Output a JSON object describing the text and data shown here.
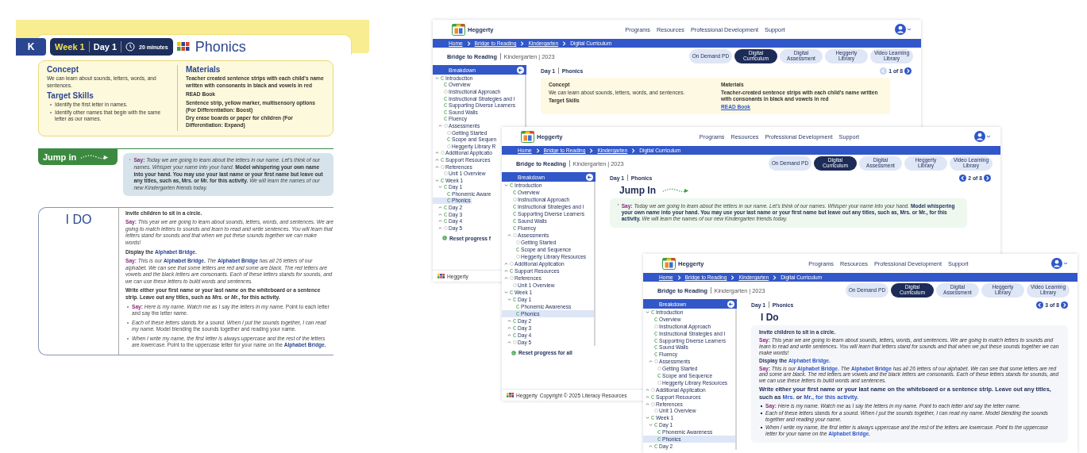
{
  "lesson_page": {
    "grade": "K",
    "week": "Week 1",
    "day": "Day 1",
    "duration": "20 minutes",
    "subject": "Phonics",
    "concept": {
      "heading": "Concept",
      "text": "We can learn about sounds, letters, words, and sentences."
    },
    "target_skills": {
      "heading": "Target Skills",
      "items": [
        "Identify the first letter in names.",
        "Identify other names that begin with the same letter as our names."
      ]
    },
    "materials": {
      "heading": "Materials",
      "items": [
        "Teacher created sentence strips with each child's name written with consonants in black and vowels in red",
        "READ Book",
        "Sentence strip, yellow marker, multisensory options (For Differentiation: Boost)",
        "Dry erase boards or paper for children (For Differentiation: Expand)"
      ]
    },
    "jump_in": {
      "label": "Jump in",
      "say": "Say:",
      "text": "*Today we are going to learn about the letters in our name. Let's think of our names. Whisper your name into your hand.* **Model whispering your own name into your hand. You may use your last name or your first name but leave out any titles, such as, Mrs. or Mr. for this activity.** *We will learn the names of our new Kindergarten friends today.*"
    },
    "i_do": {
      "label": "I DO",
      "paragraphs": [
        {
          "kind": "instruction",
          "text": "Invite children to sit in a circle."
        },
        {
          "kind": "say",
          "say": "Say:",
          "text": "*This year we are going to learn about sounds, letters, words, and sentences. We are going to match letters to sounds and learn to read and write sentences. You will learn that letters stand for sounds and that when we put these sounds together we can make words!*"
        },
        {
          "kind": "instruction",
          "text": "Display the **Alphabet Bridge.**"
        },
        {
          "kind": "say",
          "say": "Say:",
          "text": "*This is our* **Alphabet Bridge.** *The* **Alphabet Bridge** *has all 26 letters of our alphabet. We can see that some letters are red and some are black. The red letters are vowels and the black letters are consonants. Each of these letters stands for sounds, and we can use these letters to build words and sentences.*"
        },
        {
          "kind": "instruction",
          "text": "Write either your first name or your last name on the whiteboard or a sentence strip. Leave out any titles, such as *Mrs.* or *Mr.*, for this activity."
        },
        {
          "kind": "bullet",
          "say": "Say:",
          "text": "*Here is my name. Watch me as I say the letters in my name.* Point to each letter and say the letter name."
        },
        {
          "kind": "bullet",
          "text": "*Each of these letters stands for a sound. When I put the sounds together, I can read my name.* Model blending the sounds together and reading your name."
        },
        {
          "kind": "bullet",
          "text": "*When I write my name, the first letter is always uppercase and the rest of the letters are lowercase.* Point to the uppercase letter for your name on the **Alphabet Bridge.**"
        }
      ]
    }
  },
  "windows": [
    {
      "header": {
        "brand": "Heggerty",
        "nav": [
          "Programs",
          "Resources",
          "Professional Development",
          "Support"
        ],
        "avatar": true
      },
      "breadcrumbs": [
        "Home",
        "Bridge to Reading",
        "Kindergarten",
        "Digital Curriculum"
      ],
      "title": "Bridge to Reading",
      "subtitle": "Kindergarten | 2023",
      "tabs": [
        {
          "label": "On Demand PD",
          "selected": false
        },
        {
          "label": "Digital Curriculum",
          "selected": true
        },
        {
          "label": "Digital Assessment",
          "selected": false
        },
        {
          "label": "Heggerty Library",
          "selected": false
        },
        {
          "label": "Video Learning Library",
          "selected": false
        }
      ],
      "sidebar": {
        "title": "Breakdown",
        "reset": "Reset progress f",
        "items": [
          {
            "label": "Introduction",
            "done": true,
            "expanded": true,
            "selected": false,
            "children": [
              {
                "label": "Overview",
                "done": true,
                "selected": false
              },
              {
                "label": "Instructional Approach",
                "done": false,
                "selected": false
              },
              {
                "label": "Instructional Strategies and I",
                "done": true,
                "selected": false
              },
              {
                "label": "Supporting Diverse Learners",
                "done": true,
                "selected": false
              },
              {
                "label": "Sound Walls",
                "done": true,
                "selected": false
              },
              {
                "label": "Fluency",
                "done": true,
                "selected": false
              },
              {
                "label": "Assessments",
                "done": false,
                "expanded": false,
                "selected": false,
                "children": [
                  {
                    "label": "Getting Started",
                    "done": false,
                    "selected": false
                  },
                  {
                    "label": "Scope and Sequen",
                    "done": true,
                    "selected": false
                  },
                  {
                    "label": "Heggerty Library R",
                    "done": false,
                    "selected": false
                  }
                ]
              }
            ]
          },
          {
            "label": "Additional Applicatio",
            "done": false,
            "expanded": false,
            "selected": false
          },
          {
            "label": "Support Resources",
            "done": true,
            "expanded": false,
            "selected": false
          },
          {
            "label": "References",
            "done": false,
            "expanded": false,
            "selected": false,
            "children": [
              {
                "label": "Unit 1 Overview",
                "done": false,
                "selected": false
              }
            ]
          },
          {
            "label": "Week 1",
            "done": true,
            "expanded": true,
            "selected": false,
            "children": [
              {
                "label": "Day 1",
                "done": true,
                "expanded": true,
                "selected": false,
                "children": [
                  {
                    "label": "Phonemic Aware",
                    "done": true,
                    "selected": false
                  },
                  {
                    "label": "Phonics",
                    "done": true,
                    "selected": true
                  }
                ]
              },
              {
                "label": "Day 2",
                "done": true,
                "expanded": false,
                "selected": false
              },
              {
                "label": "Day 3",
                "done": true,
                "expanded": false,
                "selected": false
              },
              {
                "label": "Day 4",
                "done": true,
                "expanded": false,
                "selected": false
              },
              {
                "label": "Day 5",
                "done": false,
                "expanded": false,
                "selected": false
              }
            ]
          }
        ]
      },
      "day": "Day 1",
      "section": "Phonics",
      "pager": {
        "text": "1 of 8",
        "prev_disabled": true
      },
      "content": {
        "kind": "overview",
        "concept_heading": "Concept",
        "concept_text": "We can learn about sounds, letters, words, and sentences.",
        "skills_heading": "Target Skills",
        "materials_heading": "Materials",
        "materials_text": "Teacher-created sentence strips with each child's name written with consonants in black and vowels in red",
        "materials_link": "READ Book"
      },
      "footer": {
        "brand": "Heggerty"
      }
    },
    {
      "header": {
        "brand": "Heggerty",
        "nav": [
          "Programs",
          "Resources",
          "Professional Development",
          "Support"
        ],
        "avatar": true
      },
      "breadcrumbs": [
        "Home",
        "Bridge to Reading",
        "Kindergarten",
        "Digital Curriculum"
      ],
      "title": "Bridge to Reading",
      "subtitle": "Kindergarten | 2023",
      "tabs": [
        {
          "label": "On Demand PD",
          "selected": false
        },
        {
          "label": "Digital Curriculum",
          "selected": true
        },
        {
          "label": "Digital Assessment",
          "selected": false
        },
        {
          "label": "Heggerty Library",
          "selected": false
        },
        {
          "label": "Video Learning Library",
          "selected": false
        }
      ],
      "sidebar": {
        "title": "Breakdown",
        "reset": "Reset progress for all",
        "items": [
          {
            "label": "Introduction",
            "done": true,
            "expanded": true,
            "selected": false,
            "children": [
              {
                "label": "Overview",
                "done": true,
                "selected": false
              },
              {
                "label": "Instructional Approach",
                "done": false,
                "selected": false
              },
              {
                "label": "Instructional Strategies and I",
                "done": true,
                "selected": false
              },
              {
                "label": "Supporting Diverse Learners",
                "done": true,
                "selected": false
              },
              {
                "label": "Sound Walls",
                "done": true,
                "selected": false
              },
              {
                "label": "Fluency",
                "done": true,
                "selected": false
              },
              {
                "label": "Assessments",
                "done": false,
                "expanded": false,
                "selected": false,
                "children": [
                  {
                    "label": "Getting Started",
                    "done": false,
                    "selected": false
                  },
                  {
                    "label": "Scope and Sequence",
                    "done": true,
                    "selected": false
                  },
                  {
                    "label": "Heggerty Library Resources",
                    "done": false,
                    "selected": false
                  }
                ]
              }
            ]
          },
          {
            "label": "Additional Application",
            "done": false,
            "expanded": false,
            "selected": false
          },
          {
            "label": "Support Resources",
            "done": true,
            "expanded": false,
            "selected": false
          },
          {
            "label": "References",
            "done": false,
            "expanded": false,
            "selected": false,
            "children": [
              {
                "label": "Unit 1 Overview",
                "done": false,
                "selected": false
              }
            ]
          },
          {
            "label": "Week 1",
            "done": true,
            "expanded": true,
            "selected": false,
            "children": [
              {
                "label": "Day 1",
                "done": true,
                "expanded": true,
                "selected": false,
                "children": [
                  {
                    "label": "Phonemic Awareness",
                    "done": true,
                    "selected": false
                  },
                  {
                    "label": "Phonics",
                    "done": true,
                    "selected": true
                  }
                ]
              },
              {
                "label": "Day 2",
                "done": true,
                "expanded": false,
                "selected": false
              },
              {
                "label": "Day 3",
                "done": true,
                "expanded": false,
                "selected": false
              },
              {
                "label": "Day 4",
                "done": true,
                "expanded": false,
                "selected": false
              },
              {
                "label": "Day 5",
                "done": false,
                "expanded": false,
                "selected": false
              }
            ]
          }
        ]
      },
      "day": "Day 1",
      "section": "Phonics",
      "pager": {
        "text": "2 of 8",
        "prev_disabled": false
      },
      "content": {
        "kind": "jump_in",
        "heading": "Jump In",
        "say": "Say:",
        "text": "*Today we are going to learn about the letters in our name. Let's think of our names. Whisper your name into your hand.* **Model whispering your own name into your hand. You may use your last name or your first name but leave out any titles, such as, Mrs. or Mr., for this activity.** *We will learn the names of our new Kindergarten friends today.*"
      },
      "footer": {
        "brand": "Heggerty",
        "copyright": "Copyright © 2025 Literacy Resources"
      }
    },
    {
      "header": {
        "brand": "Heggerty",
        "nav": [
          "Programs",
          "Resources",
          "Professional Development",
          "Support"
        ],
        "avatar": true
      },
      "breadcrumbs": [
        "Home",
        "Bridge to Reading",
        "Kindergarten",
        "Digital Curriculum"
      ],
      "title": "Bridge to Reading",
      "subtitle": "Kindergarten | 2023",
      "tabs": [
        {
          "label": "On Demand PD",
          "selected": false
        },
        {
          "label": "Digital Curriculum",
          "selected": true
        },
        {
          "label": "Digital Assessment",
          "selected": false
        },
        {
          "label": "Heggerty Library",
          "selected": false
        },
        {
          "label": "Video Learning Library",
          "selected": false
        }
      ],
      "sidebar": {
        "title": "Breakdown",
        "items": [
          {
            "label": "Introduction",
            "done": true,
            "expanded": true,
            "selected": false,
            "children": [
              {
                "label": "Overview",
                "done": true,
                "selected": false
              },
              {
                "label": "Instructional Approach",
                "done": false,
                "selected": false
              },
              {
                "label": "Instructional Strategies and I",
                "done": true,
                "selected": false
              },
              {
                "label": "Supporting Diverse Learners",
                "done": true,
                "selected": false
              },
              {
                "label": "Sound Walls",
                "done": true,
                "selected": false
              },
              {
                "label": "Fluency",
                "done": true,
                "selected": false
              },
              {
                "label": "Assessments",
                "done": false,
                "expanded": false,
                "selected": false,
                "children": [
                  {
                    "label": "Getting Started",
                    "done": false,
                    "selected": false
                  },
                  {
                    "label": "Scope and Sequence",
                    "done": true,
                    "selected": false
                  },
                  {
                    "label": "Heggerty Library Resources",
                    "done": false,
                    "selected": false
                  }
                ]
              }
            ]
          },
          {
            "label": "Additional Application",
            "done": false,
            "expanded": false,
            "selected": false
          },
          {
            "label": "Support Resources",
            "done": true,
            "expanded": false,
            "selected": false
          },
          {
            "label": "References",
            "done": false,
            "expanded": false,
            "selected": false,
            "children": [
              {
                "label": "Unit 1 Overview",
                "done": false,
                "selected": false
              }
            ]
          },
          {
            "label": "Week 1",
            "done": true,
            "expanded": true,
            "selected": false,
            "children": [
              {
                "label": "Day 1",
                "done": true,
                "expanded": true,
                "selected": false,
                "children": [
                  {
                    "label": "Phonemic Awareness",
                    "done": true,
                    "selected": false
                  },
                  {
                    "label": "Phonics",
                    "done": true,
                    "selected": true
                  }
                ]
              },
              {
                "label": "Day 2",
                "done": true,
                "expanded": false,
                "selected": false
              }
            ]
          }
        ]
      },
      "day": "Day 1",
      "section": "Phonics",
      "pager": {
        "text": "3 of 8",
        "prev_disabled": false
      },
      "content": {
        "kind": "i_do",
        "heading": "I Do",
        "paragraphs": [
          {
            "kind": "instruction",
            "text": "Invite children to sit in a circle."
          },
          {
            "kind": "say",
            "say": "Say:",
            "text": "*This year we are going to learn about sounds, letters, words, and sentences. We are going to match letters to sounds and learn to read and write sentences. You will learn that letters stand for sounds and that when we put these sounds together we can make words!*"
          },
          {
            "kind": "instruction",
            "text": "Display the **Alphabet Bridge.**"
          },
          {
            "kind": "say",
            "say": "Say:",
            "text": "*This is our* **Alphabet Bridge.** *The* **Alphabet Bridge** *has all 26 letters of our alphabet. We can see that some letters are red and some are black. The red letters are vowels and the black letters are consonants. Each of these letters stands for sounds, and we can use these letters to build words and sentences.*"
          },
          {
            "kind": "callout",
            "text": "Write either your first name or your last name on the whiteboard or a sentence strip. Leave out any titles, such as **Mrs.** or **Mr., for this activity.**"
          },
          {
            "kind": "bullet",
            "say": "Say:",
            "text": "*Here is my name. Watch me as I say the letters in my name. Point to each letter and say the letter name.*"
          },
          {
            "kind": "bullet",
            "text": "*Each of these letters stands for a sound. When I put the sounds together, I can read my name. Model blending the sounds together and reading your name.*"
          },
          {
            "kind": "bullet",
            "text": "*When I write my name, the first letter is always uppercase and the rest of the letters are lowercase. Point to the uppercase letter for your name on the* **Alphabet Bridge.**"
          }
        ]
      }
    }
  ]
}
